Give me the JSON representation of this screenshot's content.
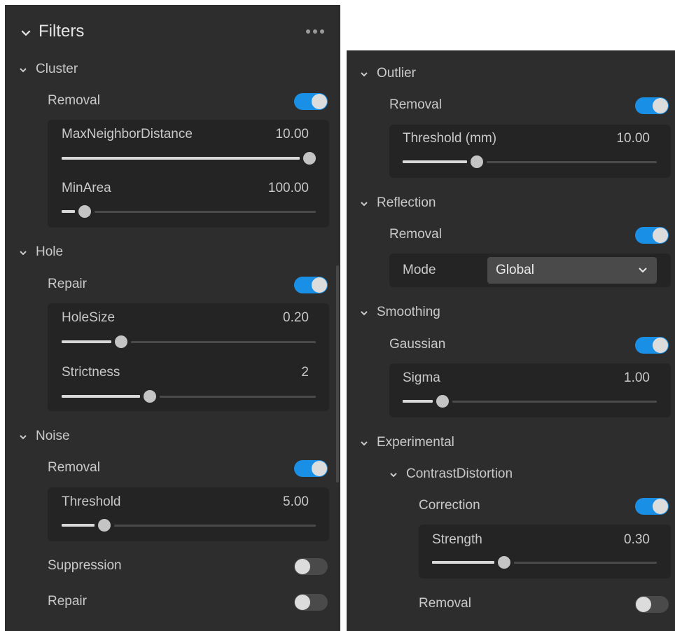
{
  "colors": {
    "panel": "#2d2d2d",
    "box": "#242424",
    "accent": "#1a8fe6",
    "text": "#c9c9c9"
  },
  "left": {
    "title": "Filters",
    "cluster": {
      "label": "Cluster",
      "removal": {
        "label": "Removal",
        "on": true
      },
      "max_neighbor_distance": {
        "label": "MaxNeighborDistance",
        "value": "10.00",
        "level": 1.0
      },
      "min_area": {
        "label": "MinArea",
        "value": "100.00",
        "level": 0.07
      }
    },
    "hole": {
      "label": "Hole",
      "repair": {
        "label": "Repair",
        "on": true
      },
      "hole_size": {
        "label": "HoleSize",
        "value": "0.20",
        "level": 0.22
      },
      "strictness": {
        "label": "Strictness",
        "value": "2",
        "level": 0.34
      }
    },
    "noise": {
      "label": "Noise",
      "removal": {
        "label": "Removal",
        "on": true
      },
      "threshold": {
        "label": "Threshold",
        "value": "5.00",
        "level": 0.15
      },
      "suppression": {
        "label": "Suppression",
        "on": false
      },
      "repair": {
        "label": "Repair",
        "on": false
      }
    }
  },
  "right": {
    "outlier": {
      "label": "Outlier",
      "removal": {
        "label": "Removal",
        "on": true
      },
      "threshold": {
        "label": "Threshold (mm)",
        "value": "10.00",
        "level": 0.28
      }
    },
    "reflection": {
      "label": "Reflection",
      "removal": {
        "label": "Removal",
        "on": true
      },
      "mode": {
        "label": "Mode",
        "value": "Global"
      }
    },
    "smoothing": {
      "label": "Smoothing",
      "gaussian": {
        "label": "Gaussian",
        "on": true
      },
      "sigma": {
        "label": "Sigma",
        "value": "1.00",
        "level": 0.14
      }
    },
    "experimental": {
      "label": "Experimental",
      "contrast_distortion": {
        "label": "ContrastDistortion",
        "correction": {
          "label": "Correction",
          "on": true
        },
        "strength": {
          "label": "Strength",
          "value": "0.30",
          "level": 0.31
        },
        "removal": {
          "label": "Removal",
          "on": false
        }
      }
    }
  }
}
